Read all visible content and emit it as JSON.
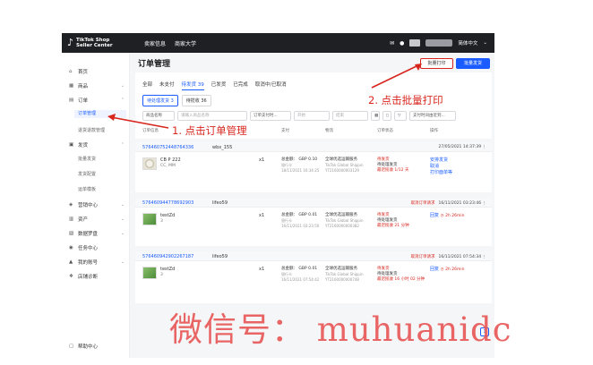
{
  "brand": {
    "name": "TikTok Shop",
    "sub": "Seller Center"
  },
  "topnav": [
    "卖家信息",
    "商家大学"
  ],
  "top_right": {
    "lang": "简体中文"
  },
  "sidebar": {
    "items": [
      {
        "icon": "home-icon",
        "label": "首页",
        "top": 0
      },
      {
        "icon": "goods-icon",
        "label": "商品"
      },
      {
        "icon": "order-icon",
        "label": "订单"
      },
      {
        "icon": "shipping-icon",
        "label": "发货"
      },
      {
        "icon": "marketing-icon",
        "label": "营销中心"
      },
      {
        "icon": "finance-icon",
        "label": "资产"
      },
      {
        "icon": "data-icon",
        "label": "数据罗盘"
      },
      {
        "icon": "task-icon",
        "label": "任务中心"
      },
      {
        "icon": "account-icon",
        "label": "我的账号"
      },
      {
        "icon": "store-icon",
        "label": "店铺诊断"
      },
      {
        "icon": "help-icon",
        "label": "帮助中心"
      }
    ],
    "order_sub": [
      "订单管理",
      "退货退款管理"
    ],
    "ship_sub": [
      "批量发货",
      "发货配置",
      "运单模板"
    ]
  },
  "main": {
    "title": "订单管理",
    "batch_print": "批量打印",
    "batch_ship": "批量发货",
    "tabs": [
      "全部",
      "未支付",
      "待发货 39",
      "已发货",
      "已完成",
      "取消中/已取消"
    ],
    "subtabs": [
      "待处理发货 3",
      "待揽收 36"
    ],
    "filters": [
      "商品名称",
      "请输入商品名称",
      "订单支付时...",
      "开始",
      "结束",
      "支付时间由近到..."
    ],
    "columns": [
      "订单信息",
      "支付",
      "物流",
      "订单状态",
      "操作"
    ]
  },
  "orders": [
    {
      "id": "576460752448764336",
      "buyer": "wbx_155",
      "right": "27/05/2021 14:37:39",
      "cancel": "",
      "product": "CB P 222",
      "sku": "CC, MM",
      "qty": "x1",
      "amount": "总金额： GBP 0.10",
      "pay_method": "银行卡",
      "paid_time": "18/11/2021 16:34:25",
      "carrier": "全球优选运输服务",
      "carrier_sub": "TikTok Global Shippin",
      "tracking": "YT2160000003129",
      "status": "待发货",
      "status_sub": "待处理发货",
      "deadline": "最迟揽收 1/12 天",
      "actions": [
        "安排发货",
        "取消",
        "打印面单等"
      ],
      "thumb": "watch"
    },
    {
      "id": "576460944778692903",
      "buyer": "lifeo59",
      "right": "16/11/2021 03:23:46",
      "cancel": "取消订单请求",
      "product": "testZd",
      "sku": "3",
      "qty": "x1",
      "amount": "总金额： GBP 0.01",
      "pay_method": "银行卡",
      "paid_time": "16/11/2021 03:23:50",
      "carrier": "全球优选运输服务",
      "carrier_sub": "TikTok Global Shippin",
      "tracking": "YT2160000000382",
      "status": "待发货",
      "status_sub": "待处理发货",
      "deadline": "最迟揽收 21 分钟",
      "actions": [
        "回复"
      ],
      "reply_time": "2h 26min",
      "thumb": "grass"
    },
    {
      "id": "576460942902267187",
      "buyer": "lifeo59",
      "right": "16/11/2021 07:54:34",
      "cancel": "取消订单请求",
      "product": "testZd",
      "sku": "3",
      "qty": "x1",
      "amount": "总金额： GBP 0.01",
      "pay_method": "银行卡",
      "paid_time": "16/11/2021 07:54:42",
      "carrier": "全球优选运输服务",
      "carrier_sub": "TikTok Global Shippin",
      "tracking": "YT2160000000748",
      "status": "待发货",
      "status_sub": "待处理发货",
      "deadline": "最迟揽收 16 小时 02 分钟",
      "actions": [
        "回复"
      ],
      "reply_time": "2h 26min",
      "thumb": "grass"
    }
  ],
  "pager": {
    "current": "1"
  },
  "annotations": {
    "step1": "1. 点击订单管理",
    "step2": "2. 点击批量打印"
  },
  "watermark": "微信号： muhuanidc",
  "colors": {
    "accent": "#1a5cff",
    "annot": "#d8261e",
    "topbar": "#1f2024"
  }
}
